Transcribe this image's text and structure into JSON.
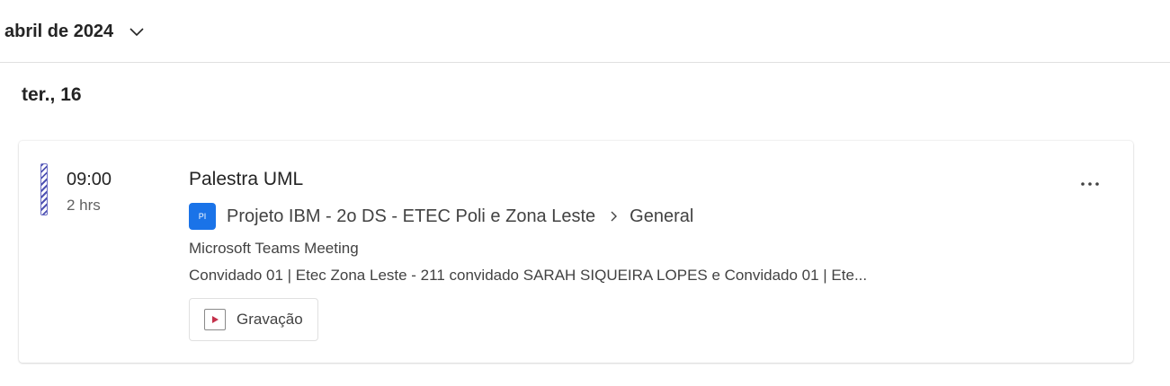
{
  "header": {
    "month_label": "abril de 2024",
    "dropdown_icon": "chevron-down-icon"
  },
  "day": {
    "label": "ter., 16"
  },
  "event": {
    "time": "09:00",
    "duration": "2 hrs",
    "title": "Palestra UML",
    "team_initials": "PI",
    "team_name": "Projeto IBM - 2o DS - ETEC Poli e Zona Leste",
    "channel_name": "General",
    "meeting_type": "Microsoft Teams Meeting",
    "attendees": "Convidado 01 | Etec Zona Leste - 211 convidado SARAH SIQUEIRA LOPES e Convidado 01 | Ete...",
    "recording_label": "Gravação",
    "more_icon": "more-options-icon",
    "colors": {
      "stripe": "#4f52b2",
      "team_avatar": "#1a73e8",
      "recording_play": "#c4314b"
    }
  }
}
